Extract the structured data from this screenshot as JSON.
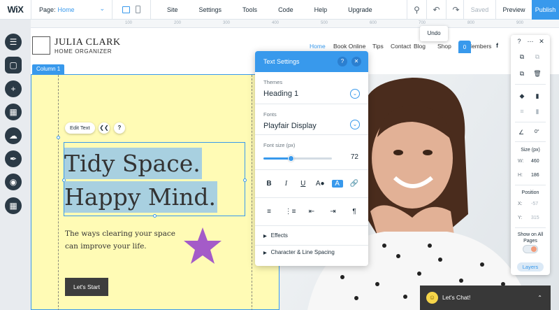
{
  "topbar": {
    "logo": "WiX",
    "page_label": "Page:",
    "page_value": "Home",
    "menu": [
      "Site",
      "Settings",
      "Tools",
      "Code",
      "Help",
      "Upgrade"
    ],
    "saved": "Saved",
    "preview": "Preview",
    "publish": "Publish"
  },
  "ruler_ticks": [
    "100",
    "200",
    "300",
    "400",
    "500",
    "600",
    "700",
    "800",
    "900"
  ],
  "undo_tooltip": "Undo",
  "site": {
    "brand_name": "JULIA CLARK",
    "brand_sub": "HOME ORGANIZER",
    "nav": [
      "Home",
      "Book Online",
      "Tips",
      "Contact",
      "Blog",
      "Shop",
      "Members"
    ],
    "cart_count": "0",
    "column_label": "Column 1",
    "edit_text": "Edit Text",
    "headline_line1": "Tidy Space.",
    "headline_line2": "Happy Mind.",
    "paragraph": "The ways clearing your space can improve your life.",
    "cta": "Let's Start"
  },
  "text_settings": {
    "title": "Text Settings",
    "help": "?",
    "themes_label": "Themes",
    "themes_value": "Heading 1",
    "fonts_label": "Fonts",
    "fonts_value": "Playfair Display",
    "font_size_label": "Font size (px)",
    "font_size_value": "72",
    "font_size_fraction": 0.4,
    "effects": "Effects",
    "char_spacing": "Character & Line Spacing"
  },
  "right_tools": {
    "rotation": "0°",
    "size_label": "Size (px)",
    "w_label": "W:",
    "w_value": "460",
    "h_label": "H:",
    "h_value": "186",
    "position_label": "Position",
    "x_label": "X:",
    "x_value": "-57",
    "y_label": "Y:",
    "y_value": "315",
    "show_on_all_pages": "Show on All Pages",
    "layers": "Layers"
  },
  "chat": {
    "label": "Let's Chat!"
  },
  "colors": {
    "accent": "#3899ec",
    "column_bg": "#fffbb5",
    "star": "#a45bc8",
    "cta_bg": "#3d3d3d"
  }
}
